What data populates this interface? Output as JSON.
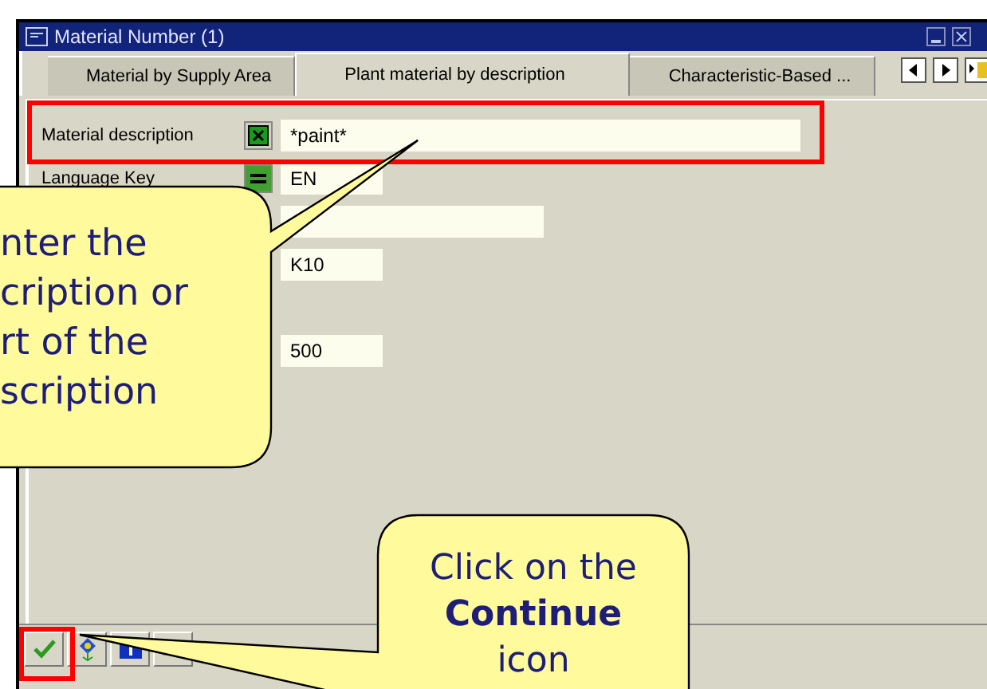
{
  "window": {
    "title": "Material Number (1)"
  },
  "tabs": [
    {
      "label": "Material by Supply Area",
      "selected": false
    },
    {
      "label": "Plant material by description",
      "selected": true
    },
    {
      "label": "Characteristic-Based ...",
      "selected": false
    }
  ],
  "fields": [
    {
      "label": "Material description",
      "kind": "pattern",
      "value": "*paint*"
    },
    {
      "label": "Language Key",
      "kind": "equals",
      "value": "EN"
    },
    {
      "kind": "plain"
    },
    {
      "kind": "plain",
      "value": "K10"
    },
    {
      "kind": "empty"
    },
    {
      "kind": "plain",
      "value": "500"
    }
  ],
  "callouts": [
    {
      "lines": [
        "nter the",
        "cription or",
        "rt of the",
        "scription"
      ]
    },
    {
      "lines": [
        "Click on the",
        "**Continue**",
        "icon"
      ]
    }
  ]
}
